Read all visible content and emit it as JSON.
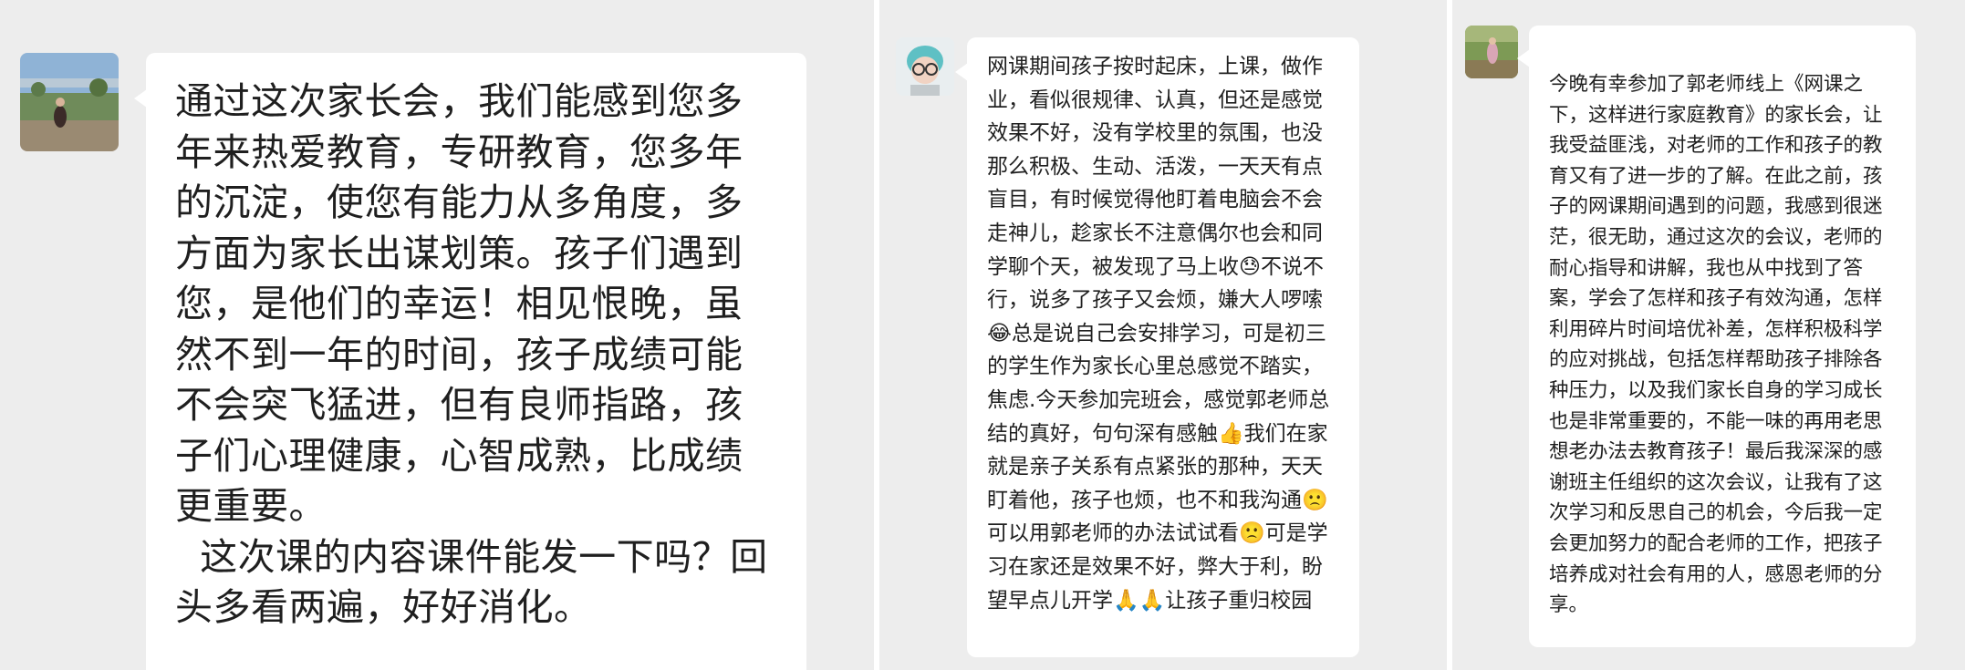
{
  "messages": [
    {
      "text": "通过这次家长会，我们能感到您多年来热爱教育，专研教育，您多年的沉淀，使您有能力从多角度，多方面为家长出谋划策。孩子们遇到您，是他们的幸运！相见恨晚，虽然不到一年的时间，孩子成绩可能不会突飞猛进，但有良师指路，孩子们心理健康，心智成熟，比成绩更重要。\n  这次课的内容课件能发一下吗？回头多看两遍，好好消化。"
    },
    {
      "text": "网课期间孩子按时起床，上课，做作业，看似很规律、认真，但还是感觉效果不好，没有学校里的氛围，也没那么积极、生动、活泼，一天天有点盲目，有时候觉得他盯着电脑会不会走神儿，趁家长不注意偶尔也会和同学聊个天，被发现了马上收😓不说不行，说多了孩子又会烦，嫌大人啰嗦😂总是说自己会安排学习，可是初三的学生作为家长心里总感觉不踏实，焦虑.今天参加完班会，感觉郭老师总结的真好，句句深有感触👍我们在家就是亲子关系有点紧张的那种，天天盯着他，孩子也烦，也不和我沟通🙁可以用郭老师的办法试试看🙁可是学习在家还是效果不好，弊大于利，盼望早点儿开学🙏🙏让孩子重归校园"
    },
    {
      "text": "今晚有幸参加了郭老师线上《网课之下，这样进行家庭教育》的家长会，让我受益匪浅，对老师的工作和孩子的教育又有了进一步的了解。在此之前，孩子的网课期间遇到的问题，我感到很迷茫，很无助，通过这次的会议，老师的耐心指导和讲解，我也从中找到了答案，学会了怎样和孩子有效沟通，怎样利用碎片时间培优补差，怎样积极科学的应对挑战，包括怎样帮助孩子排除各种压力，以及我们家长自身的学习成长也是非常重要的，不能一味的再用老思想老办法去教育孩子！最后我深深的感谢班主任组织的这次会议，让我有了这次学习和反思自己的机会，今后我一定会更加努力的配合老师的工作，把孩子培养成对社会有用的人，感恩老师的分享。"
    }
  ],
  "colors": {
    "background": "#ededed",
    "bubble": "#ffffff",
    "text": "#1f1f1f"
  }
}
